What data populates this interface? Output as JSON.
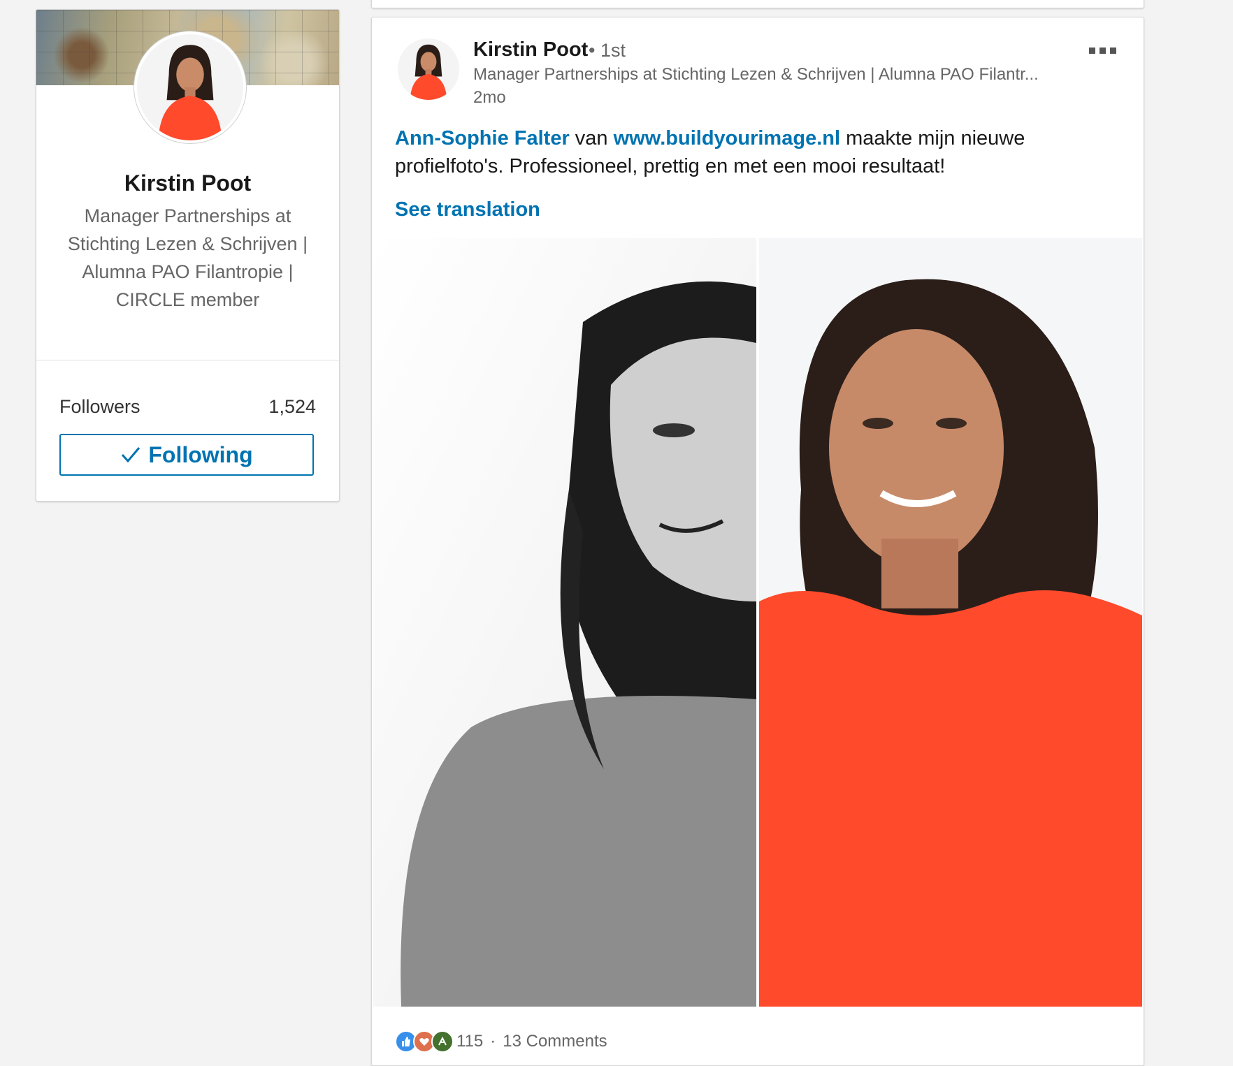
{
  "profile": {
    "name": "Kirstin Poot",
    "headline": "Manager Partnerships at Stichting Lezen & Schrijven | Alumna PAO Filantropie | CIRCLE member",
    "followers_label": "Followers",
    "followers_count": "1,524",
    "following_label": "Following"
  },
  "post": {
    "author": "Kirstin Poot",
    "degree": "• 1st",
    "headline": "Manager Partnerships at Stichting Lezen & Schrijven | Alumna PAO Filantr...",
    "time": "2mo",
    "mention": "Ann-Sophie Falter",
    "text_van": "van",
    "link": "www.buildyourimage.nl",
    "text_rest": "maakte mijn nieuwe profielfoto's. Professioneel, prettig en met een mooi resultaat!",
    "see_translation": "See translation",
    "reactions_count": "115",
    "separator": "·",
    "comments": "13 Comments",
    "reaction_icons": [
      "like-icon",
      "love-icon",
      "celebrate-icon"
    ]
  },
  "colors": {
    "link": "#0073b1",
    "shirt": "#ff4a2c",
    "background": "#f3f3f3"
  }
}
